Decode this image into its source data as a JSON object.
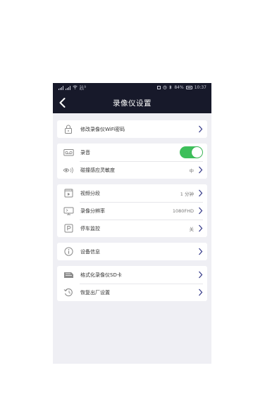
{
  "status_bar": {
    "net_speed": "50.9\nK/s",
    "battery": "84%",
    "time": "10:37"
  },
  "header": {
    "title": "录像仪设置"
  },
  "groups": [
    {
      "rows": [
        {
          "icon": "lock-icon",
          "label": "修改录像仪WiFi密码",
          "value": ""
        }
      ]
    },
    {
      "rows": [
        {
          "icon": "recorder-icon",
          "label": "录音",
          "toggle": true
        },
        {
          "icon": "sensor-icon",
          "label": "碰撞感应灵敏度",
          "value": "中"
        }
      ]
    },
    {
      "rows": [
        {
          "icon": "video-segment-icon",
          "label": "视频分段",
          "value": "1 分钟"
        },
        {
          "icon": "resolution-icon",
          "label": "录像分辨率",
          "value": "1080FHD"
        },
        {
          "icon": "parking-icon",
          "label": "停车监控",
          "value": "关"
        }
      ]
    },
    {
      "rows": [
        {
          "icon": "info-icon",
          "label": "设备信息",
          "value": ""
        }
      ]
    },
    {
      "rows": [
        {
          "icon": "sd-card-icon",
          "label": "格式化录像仪SD卡",
          "value": ""
        },
        {
          "icon": "restore-icon",
          "label": "恢复出厂设置",
          "value": ""
        }
      ]
    }
  ],
  "colors": {
    "header_bg": "#17192a",
    "toggle_on": "#3dbf5a",
    "chevron": "#3b3f8c",
    "page_bg": "#efeff4"
  }
}
